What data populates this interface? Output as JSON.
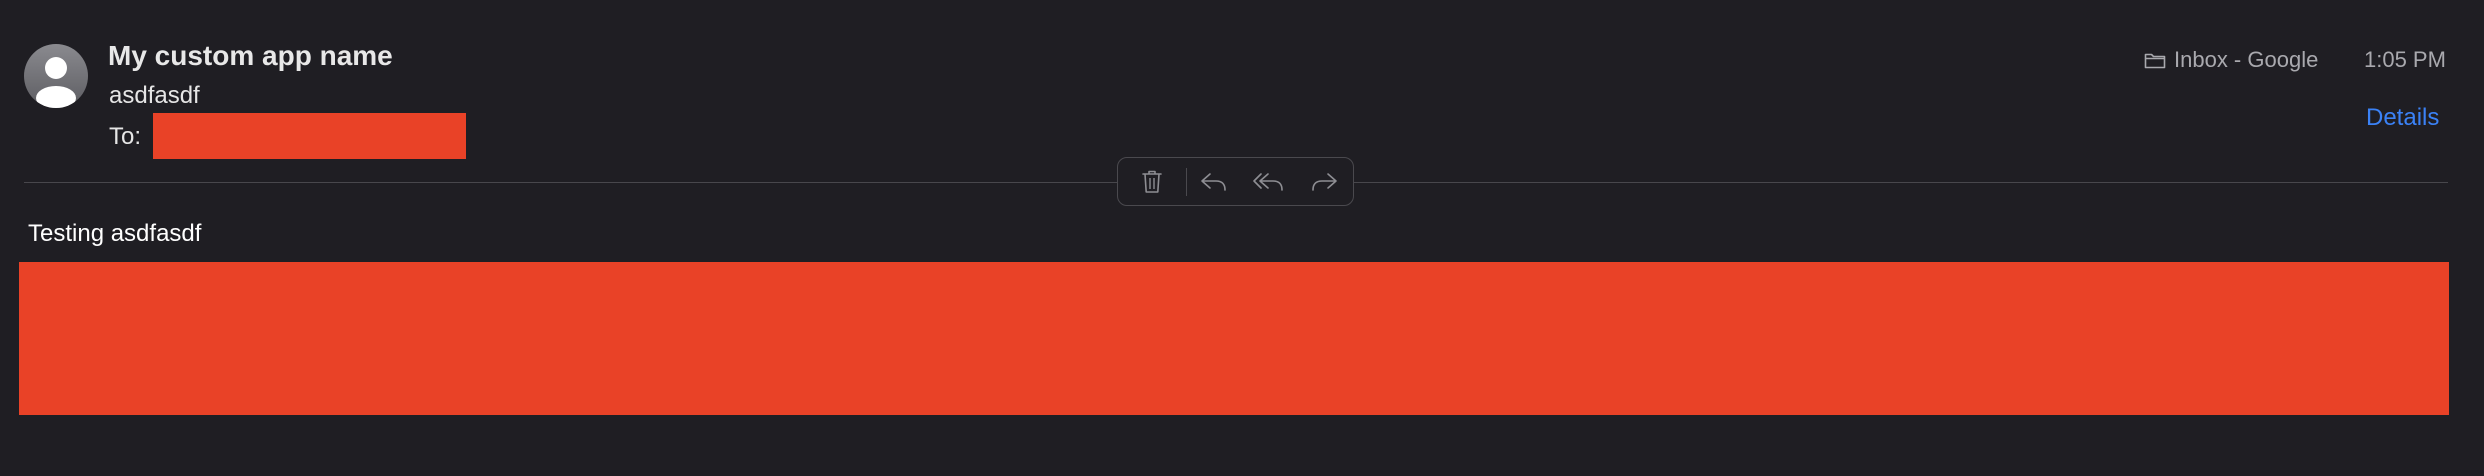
{
  "message": {
    "sender_name": "My custom app name",
    "subject": "asdfasdf",
    "to_label": "To:",
    "mailbox": "Inbox - Google",
    "time": "1:05 PM",
    "details_label": "Details",
    "body_text": "Testing asdfasdf"
  },
  "toolbar": {
    "buttons": [
      "trash-icon",
      "reply-icon",
      "reply-all-icon",
      "forward-icon"
    ]
  },
  "colors": {
    "background": "#1f1e23",
    "accent": "#3b82f6",
    "redaction": "#e94227",
    "secondary_text": "#a9a9ae"
  }
}
